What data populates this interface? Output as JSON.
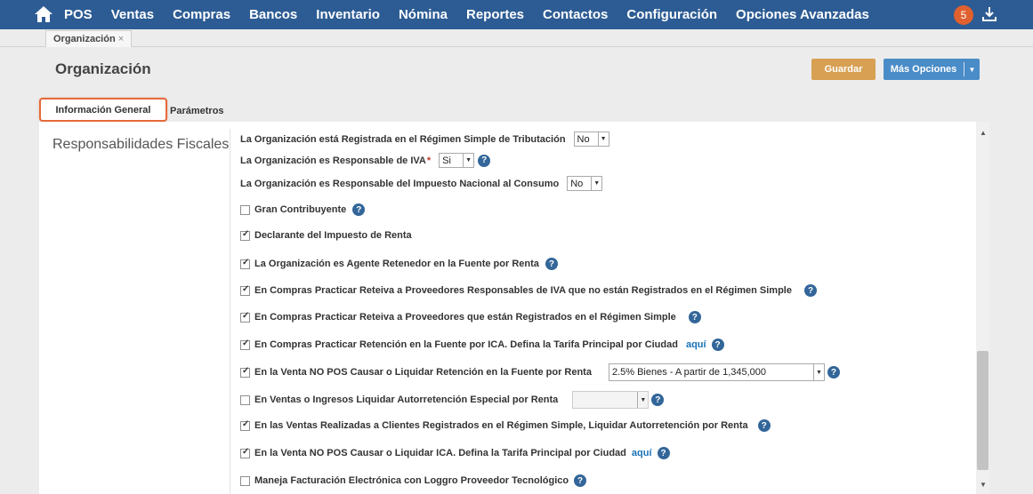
{
  "nav": {
    "items": [
      "POS",
      "Ventas",
      "Compras",
      "Bancos",
      "Inventario",
      "Nómina",
      "Reportes",
      "Contactos",
      "Configuración",
      "Opciones Avanzadas"
    ],
    "notification_count": "5",
    "home_icon": "home-icon",
    "download_icon": "download-icon"
  },
  "doc_tab": {
    "label": "Organización",
    "close": "×"
  },
  "page": {
    "title": "Organización"
  },
  "toolbar": {
    "save_label": "Guardar",
    "more_label": "Más Opciones"
  },
  "tabs": {
    "info": "Información General",
    "params": "Parámetros"
  },
  "section": {
    "title": "Responsabilidades Fiscales"
  },
  "fields": {
    "regimen_simple": {
      "label": "La Organización está Registrada en el Régimen Simple de Tributación",
      "value": "No"
    },
    "iva": {
      "label": "La Organización es Responsable de IVA",
      "required": "*",
      "value": "Si"
    },
    "impuesto_consumo": {
      "label": "La Organización es Responsable del Impuesto Nacional al Consumo",
      "value": "No"
    }
  },
  "checks": [
    {
      "label": "Gran Contribuyente",
      "checked": false
    },
    {
      "label": "Declarante del Impuesto de Renta",
      "checked": true
    },
    {
      "label": "La Organización es Agente Retenedor en la Fuente por Renta",
      "checked": true
    },
    {
      "label": "En Compras Practicar Reteiva a Proveedores Responsables de IVA que no están Registrados en el Régimen Simple",
      "checked": true
    },
    {
      "label": "En Compras Practicar Reteiva a Proveedores que están Registrados en el Régimen Simple",
      "checked": true
    },
    {
      "label": "En Compras Practicar Retención en la Fuente por ICA. Defina la Tarifa Principal por Ciudad",
      "checked": true,
      "link": "aquí"
    },
    {
      "label": "En la Venta NO POS Causar o Liquidar Retención en la Fuente por Renta",
      "checked": true,
      "select_value": "2.5% Bienes - A partir de 1,345,000"
    },
    {
      "label": "En Ventas o Ingresos Liquidar Autorretención Especial por Renta",
      "checked": false,
      "select_value": ""
    },
    {
      "label": "En las Ventas Realizadas a Clientes Registrados en el Régimen Simple, Liquidar Autorretención por Renta",
      "checked": true
    },
    {
      "label": "En la Venta NO POS Causar o Liquidar ICA. Defina la Tarifa Principal por Ciudad",
      "checked": true,
      "link": "aquí"
    },
    {
      "label": "Maneja Facturación Electrónica con Loggro Proveedor Tecnológico",
      "checked": false
    }
  ],
  "help_glyph": "?"
}
